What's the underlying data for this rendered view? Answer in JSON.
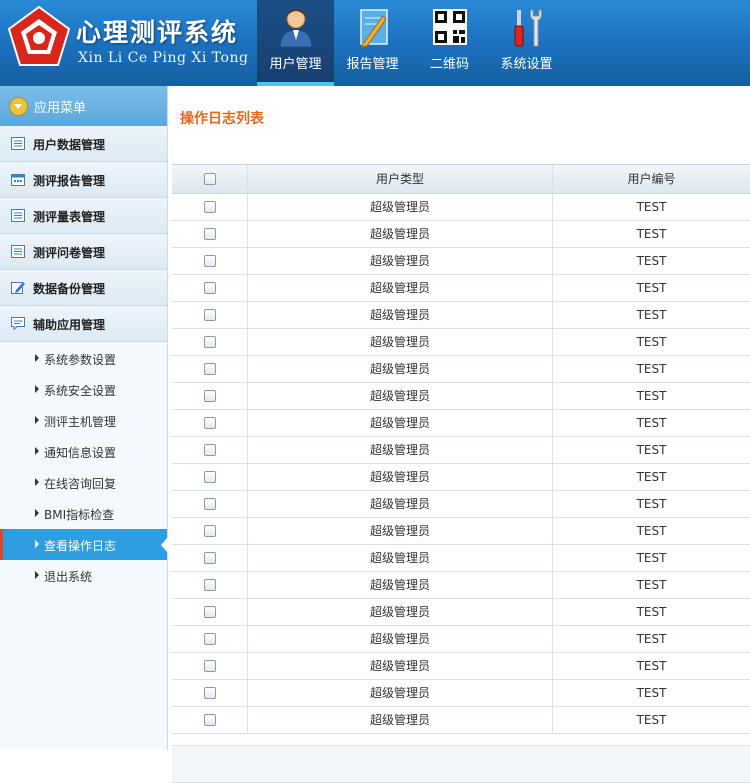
{
  "header": {
    "title": "心理测评系统",
    "subtitle": "Xin Li Ce Ping Xi Tong"
  },
  "nav": [
    {
      "label": "用户管理",
      "icon": "user-icon",
      "active": true
    },
    {
      "label": "报告管理",
      "icon": "report-icon",
      "active": false
    },
    {
      "label": "二维码",
      "icon": "qrcode-icon",
      "active": false
    },
    {
      "label": "系统设置",
      "icon": "tools-icon",
      "active": false
    }
  ],
  "sidebar": {
    "header": "应用菜单",
    "sections": [
      {
        "label": "用户数据管理",
        "icon": "list-icon"
      },
      {
        "label": "测评报告管理",
        "icon": "calendar-icon"
      },
      {
        "label": "测评量表管理",
        "icon": "list-icon"
      },
      {
        "label": "测评问卷管理",
        "icon": "list-icon"
      },
      {
        "label": "数据备份管理",
        "icon": "edit-icon"
      },
      {
        "label": "辅助应用管理",
        "icon": "chat-icon"
      }
    ],
    "subitems": [
      {
        "label": "系统参数设置",
        "active": false
      },
      {
        "label": "系统安全设置",
        "active": false
      },
      {
        "label": "测评主机管理",
        "active": false
      },
      {
        "label": "通知信息设置",
        "active": false
      },
      {
        "label": "在线咨询回复",
        "active": false
      },
      {
        "label": "BMI指标检查",
        "active": false
      },
      {
        "label": "查看操作日志",
        "active": true
      },
      {
        "label": "退出系统",
        "active": false
      }
    ]
  },
  "main": {
    "title": "操作日志列表",
    "columns": [
      "用户类型",
      "用户编号"
    ],
    "rows": [
      {
        "type": "超级管理员",
        "id": "TEST"
      },
      {
        "type": "超级管理员",
        "id": "TEST"
      },
      {
        "type": "超级管理员",
        "id": "TEST"
      },
      {
        "type": "超级管理员",
        "id": "TEST"
      },
      {
        "type": "超级管理员",
        "id": "TEST"
      },
      {
        "type": "超级管理员",
        "id": "TEST"
      },
      {
        "type": "超级管理员",
        "id": "TEST"
      },
      {
        "type": "超级管理员",
        "id": "TEST"
      },
      {
        "type": "超级管理员",
        "id": "TEST"
      },
      {
        "type": "超级管理员",
        "id": "TEST"
      },
      {
        "type": "超级管理员",
        "id": "TEST"
      },
      {
        "type": "超级管理员",
        "id": "TEST"
      },
      {
        "type": "超级管理员",
        "id": "TEST"
      },
      {
        "type": "超级管理员",
        "id": "TEST"
      },
      {
        "type": "超级管理员",
        "id": "TEST"
      },
      {
        "type": "超级管理员",
        "id": "TEST"
      },
      {
        "type": "超级管理员",
        "id": "TEST"
      },
      {
        "type": "超级管理员",
        "id": "TEST"
      },
      {
        "type": "超级管理员",
        "id": "TEST"
      },
      {
        "type": "超级管理员",
        "id": "TEST"
      }
    ]
  },
  "colors": {
    "header_blue": "#1b6fbd",
    "active_menu": "#2e9ee0",
    "title_orange": "#e06a1a"
  }
}
